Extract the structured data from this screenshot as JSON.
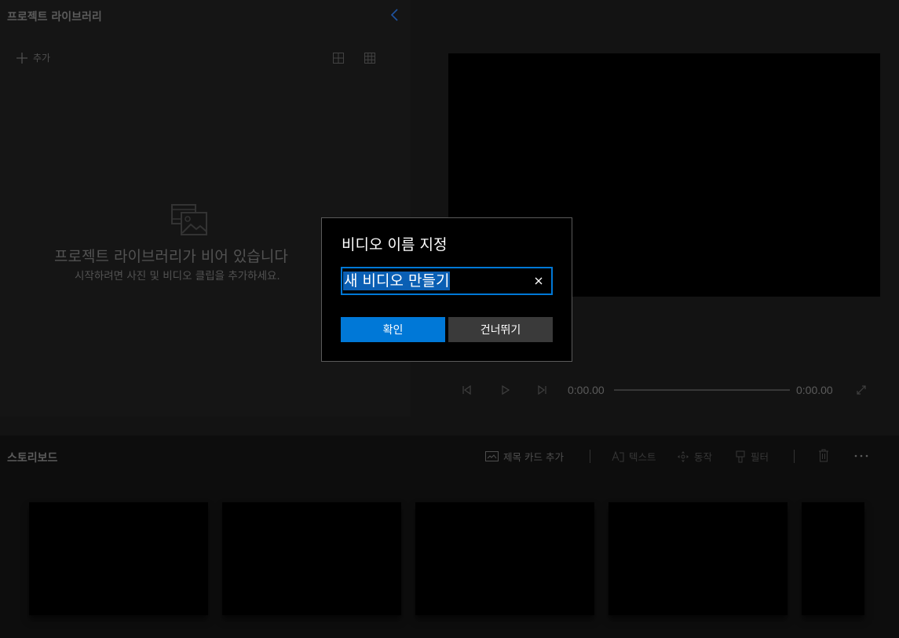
{
  "library": {
    "title": "프로젝트 라이브러리",
    "add_label": "추가",
    "empty_title": "프로젝트 라이브러리가 비어 있습니다",
    "empty_subtitle": "시작하려면 사진 및 비디오 클립을 추가하세요."
  },
  "playback": {
    "current_time": "0:00.00",
    "total_time": "0:00.00",
    "progress": 0
  },
  "storyboard": {
    "title": "스토리보드",
    "tools": {
      "title_card": "제목 카드 추가",
      "text": "텍스트",
      "motion": "동작",
      "filter": "필터"
    }
  },
  "dialog": {
    "title": "비디오 이름 지정",
    "input_value": "새 비디오 만들기",
    "confirm_label": "확인",
    "skip_label": "건너뛰기"
  },
  "colors": {
    "accent": "#0078d7",
    "background": "#1a1a1a",
    "dialog_background": "#000000"
  },
  "icons": [
    "chevron-left-icon",
    "plus-icon",
    "grid-large-icon",
    "grid-small-icon",
    "photo-library-icon",
    "previous-frame-icon",
    "play-icon",
    "next-frame-icon",
    "fullscreen-icon",
    "title-card-icon",
    "text-icon",
    "motion-icon",
    "filter-icon",
    "trash-icon",
    "more-icon",
    "close-icon"
  ]
}
